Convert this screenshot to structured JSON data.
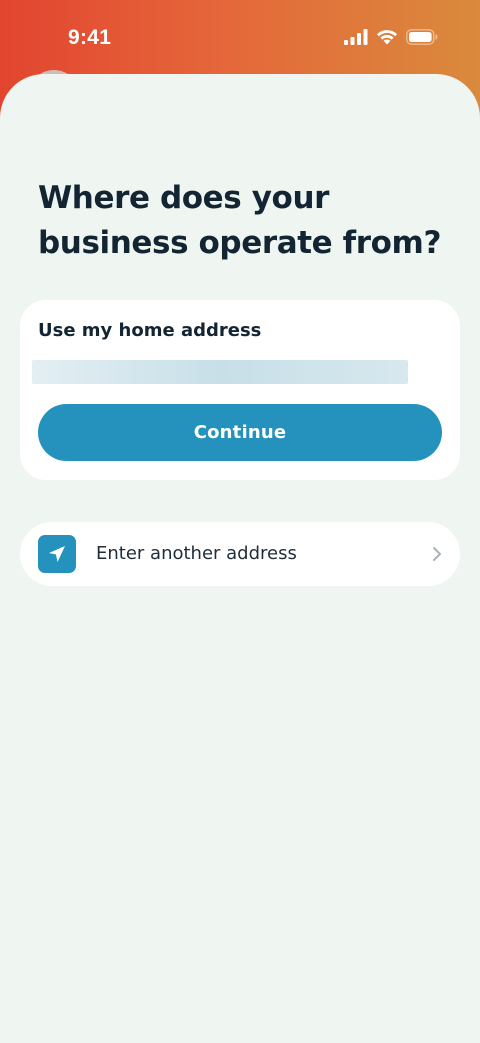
{
  "status_bar": {
    "time": "9:41",
    "icons": [
      "cellular-signal-icon",
      "wifi-icon",
      "battery-icon"
    ]
  },
  "page": {
    "title": "Where does your business operate from?"
  },
  "home_address_card": {
    "label": "Use my home address",
    "address_value": "",
    "continue_label": "Continue"
  },
  "another_address": {
    "icon": "location-arrow-icon",
    "label": "Enter another address",
    "chevron": "chevron-right-icon"
  },
  "colors": {
    "accent": "#2592bd",
    "sheet_background": "#eff6f2",
    "header_gradient_start": "#e2452f",
    "header_gradient_end": "#d98a3c",
    "title_text": "#132532"
  }
}
